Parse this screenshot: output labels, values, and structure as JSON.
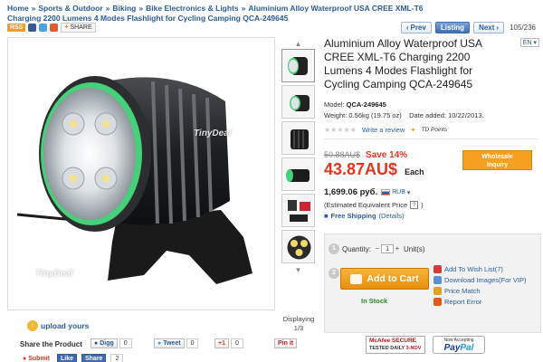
{
  "breadcrumb": {
    "items": [
      "Home",
      "Sports & Outdoor",
      "Biking",
      "Bike Electronics & Lights",
      "Aluminium Alloy Waterproof USA CREE XML-T6 Charging 2200 Lumens 4 Modes Flashlight for Cycling Camping QCA-249645"
    ],
    "separator": "»"
  },
  "pager": {
    "prev_label": "Prev",
    "listing_label": "Listing",
    "next_label": "Next",
    "count": "105/236"
  },
  "toolbar": {
    "rss_label": "RSS",
    "share_label": "SHARE"
  },
  "watermark": "TinyDeal",
  "thumbnails": {
    "display_label": "Displaying",
    "display_count": "1/3"
  },
  "upload": {
    "label": "upload yours"
  },
  "share": {
    "title": "Share the Product",
    "digg_label": "Digg",
    "digg_count": "0",
    "tweet_label": "Tweet",
    "tweet_count": "0",
    "gplus_label": "+1",
    "gplus_count": "0",
    "pinit_label": "Pin it",
    "submit_label": "Submit",
    "like_label": "Like",
    "share_label": "Share",
    "fb_count": "2"
  },
  "product": {
    "title": "Aluminium Alloy Waterproof USA CREE XML-T6 Charging 2200 Lumens 4 Modes Flashlight for Cycling Camping QCA-249645",
    "lang": "EN",
    "model_label": "Model:",
    "model": "QCA-249645",
    "weight_label": "Weight:",
    "weight": "0.56kg (19.75 oz)",
    "date_label": "Date added:",
    "date": "10/22/2013.",
    "write_review": "Write a review",
    "td_points": "TD Points"
  },
  "pricing": {
    "old_price": "50.88AU$",
    "save": "Save 14%",
    "price": "43.87AU$",
    "each": "Each",
    "wholesale_line1": "Wholesale",
    "wholesale_line2": "Inquiry",
    "rub_price": "1,699.06 руб.",
    "rub_currency": "RUB",
    "equiv": "(Estimated Equivalent Price",
    "equiv_end": ")",
    "free_shipping": "Free Shipping",
    "details": "(Details)"
  },
  "cart": {
    "step1": "1",
    "step2": "2",
    "quantity_label": "Quantity:",
    "quantity_value": "1",
    "unit_label": "Unit(s)",
    "add_to_cart": "Add to Cart",
    "in_stock": "In Stock",
    "wishlist": "Add To Wish List(7)",
    "download": "Download Images(For VIP)",
    "price_match": "Price Match",
    "report_error": "Report Error"
  },
  "badges": {
    "mcafee": "McAfee SECURE",
    "mcafee_sub": "TESTED DAILY",
    "mcafee_date": "3-NOV",
    "paypal_top": "Now Accepting",
    "paypal_pay": "Pay",
    "paypal_pal": "Pal"
  },
  "colors": {
    "link": "#2a5d9f",
    "price_red": "#e4341f",
    "cart_orange": "#f0a020",
    "stock_green": "#2b8a2b"
  }
}
